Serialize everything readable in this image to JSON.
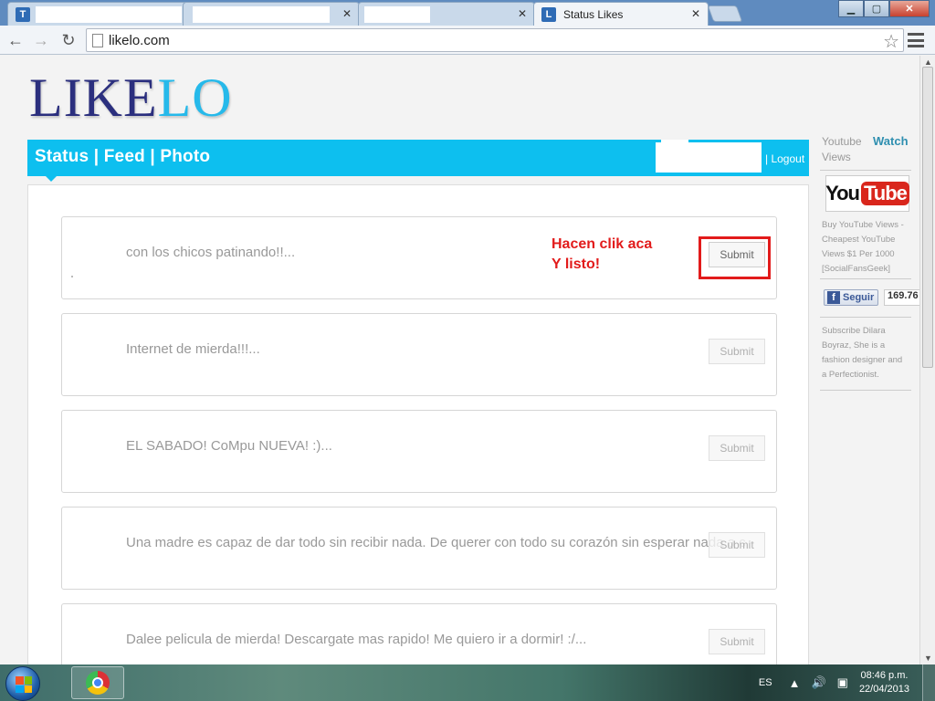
{
  "browser": {
    "tabs": [
      {
        "favicon": "T",
        "title": ""
      },
      {
        "favicon": "",
        "title": ""
      },
      {
        "favicon": "",
        "title": ""
      },
      {
        "favicon": "L",
        "title": "Status Likes"
      }
    ],
    "url": "likelo.com",
    "window_buttons": {
      "minimize": "▁",
      "maximize": "▢",
      "close": "✕"
    }
  },
  "logo": {
    "part1": "LIKE",
    "part2": "LO"
  },
  "nav": {
    "label": "Status | Feed | Photo",
    "logout": "| Logout"
  },
  "posts": [
    {
      "text": "con los chicos patinando!!...",
      "button": "Submit"
    },
    {
      "text": "Internet de mierda!!!...",
      "button": "Submit"
    },
    {
      "text": "EL SABADO! CoMpu NUEVA! :)...",
      "button": "Submit"
    },
    {
      "text": "Una madre es capaz de dar todo sin recibir nada. De querer con todo su corazón sin esperar nada a c",
      "button": "Submit"
    },
    {
      "text": "Dalee pelicula de mierda! Descargate mas rapido! Me quiero ir a dormir! :/...",
      "button": "Submit"
    }
  ],
  "annotation": {
    "line1": "Hacen clik aca",
    "line2": "Y listo!"
  },
  "sidebar": {
    "yt_label": "Youtube Views",
    "watch": "Watch",
    "yt_logo_you": "You",
    "yt_logo_tube": "Tube",
    "ad_text": "Buy YouTube Views - Cheapest YouTube Views $1 Per 1000 [SocialFansGeek]",
    "fb_button": "Seguir",
    "fb_count": "169.76",
    "subscribe_text": "Subscribe Dilara Boyraz, She is a fashion designer and a Perfectionist."
  },
  "taskbar": {
    "lang": "ES",
    "time": "08:46 p.m.",
    "date": "22/04/2013"
  },
  "colors": {
    "accent": "#0dbfef",
    "logo_dark": "#2b2f7e",
    "logo_light": "#26b9ea",
    "annotation": "#e21b1b"
  }
}
